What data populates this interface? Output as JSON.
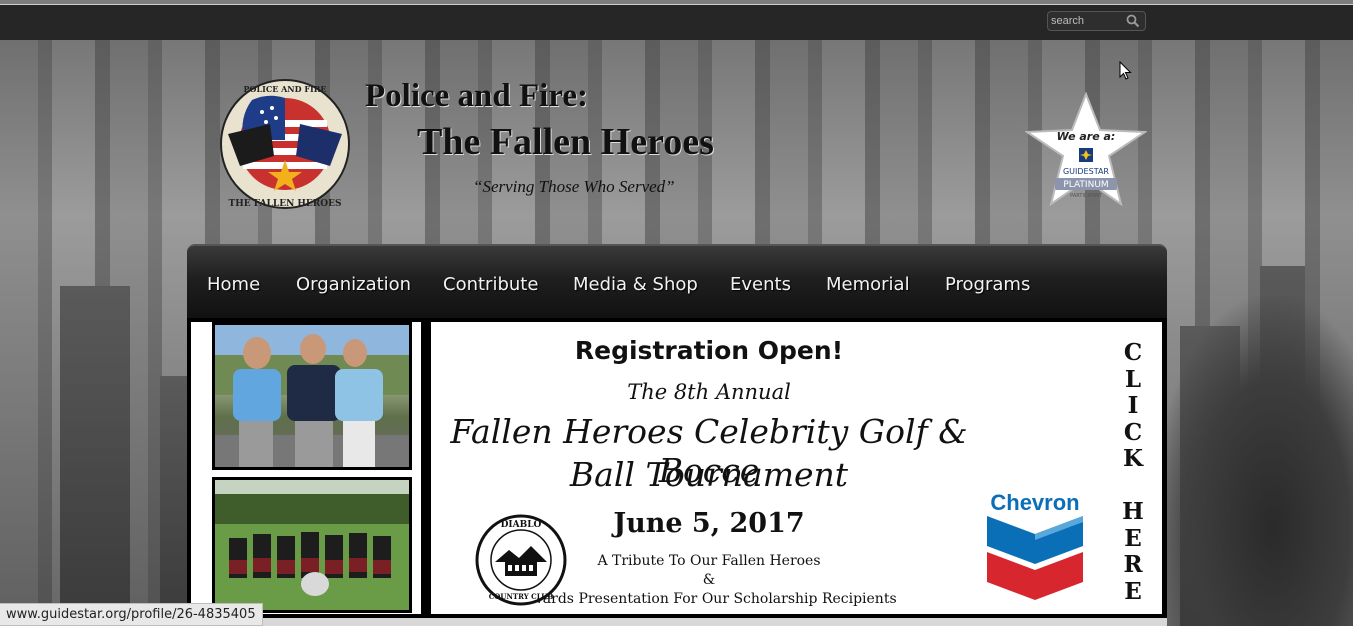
{
  "search": {
    "placeholder": "search"
  },
  "header": {
    "title_line1": "Police and Fire:",
    "title_line2": "The Fallen Heroes",
    "tagline": "“Serving Those Who Served”",
    "logo": {
      "top_text": "POLICE AND FIRE",
      "bottom_text": "THE FALLEN HEROES"
    },
    "guidestar": {
      "line1": "We are a:",
      "brand": "GUIDESTAR",
      "level": "PLATINUM",
      "sub": "PARTICIPANT"
    }
  },
  "nav": {
    "items": [
      "Home",
      "Organization",
      "Contribute",
      "Media & Shop",
      "Events",
      "Memorial",
      "Programs"
    ]
  },
  "banner": {
    "registration": "Registration Open!",
    "annual": "The 8th Annual",
    "event_line1": "Fallen Heroes Celebrity Golf & Bocce",
    "event_line2": "Ball Tournament",
    "date": "June 5, 2017",
    "tribute_line1": "A Tribute To Our Fallen Heroes",
    "tribute_amp": "&",
    "tribute_line2": "Awards Presentation For Our Scholarship Recipients",
    "diablo_logo": {
      "top": "DIABLO",
      "bottom": "COUNTRY CLUB"
    },
    "sponsor": "Chevron",
    "click_here": [
      "C",
      "L",
      "I",
      "C",
      "K",
      "",
      "H",
      "E",
      "R",
      "E"
    ]
  },
  "status_bar": {
    "url": "www.guidestar.org/profile/26-4835405"
  },
  "colors": {
    "topbar": "#262626",
    "nav": "#1f1f1f",
    "chevron_blue": "#0b6fb8",
    "chevron_red": "#d7262e"
  }
}
